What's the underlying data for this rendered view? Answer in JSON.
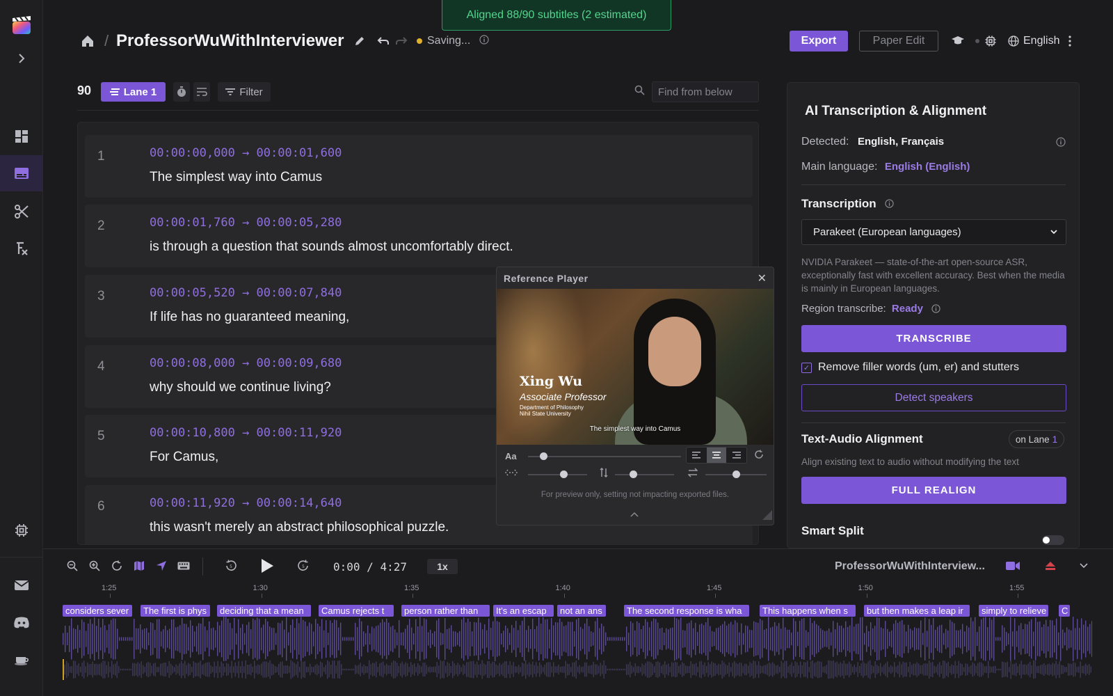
{
  "toast": "Aligned 88/90 subtitles (2 estimated)",
  "header": {
    "separator": "/",
    "title": "ProfessorWuWithInterviewer",
    "saving": "Saving...",
    "export_label": "Export",
    "paper_edit_label": "Paper Edit",
    "language": "English"
  },
  "list_toolbar": {
    "count": "90",
    "lane_label": "Lane 1",
    "filter_label": "Filter",
    "find_placeholder": "Find from below"
  },
  "subtitles": [
    {
      "num": "1",
      "start": "00:00:00,000",
      "end": "00:00:01,600",
      "text": "The simplest way into Camus"
    },
    {
      "num": "2",
      "start": "00:00:01,760",
      "end": "00:00:05,280",
      "text": "is through a question that sounds almost uncomfortably direct."
    },
    {
      "num": "3",
      "start": "00:00:05,520",
      "end": "00:00:07,840",
      "text": "If life has no guaranteed meaning,"
    },
    {
      "num": "4",
      "start": "00:00:08,000",
      "end": "00:00:09,680",
      "text": "why should we continue living?"
    },
    {
      "num": "5",
      "start": "00:00:10,800",
      "end": "00:00:11,920",
      "text": "For Camus,"
    },
    {
      "num": "6",
      "start": "00:00:11,920",
      "end": "00:00:14,640",
      "text": "this wasn't merely an abstract philosophical puzzle."
    }
  ],
  "player": {
    "title": "Reference Player",
    "lower_third": {
      "name": "Xing Wu",
      "role": "Associate Professor",
      "department": "Department of Philosophy",
      "university": "Nihil State University"
    },
    "caption": "The simplest way into Camus",
    "font_label": "Aa",
    "note": "For preview only, setting not impacting exported files.",
    "font_size_level": 0.1,
    "h_offset_level": 0.6,
    "v_offset_level": 0.3,
    "spacing_level": 0.5
  },
  "panel": {
    "title": "AI Transcription & Alignment",
    "detected_label": "Detected:",
    "detected_value": "English, Français",
    "main_language_label": "Main language:",
    "main_language_value": "English (English)",
    "transcription_heading": "Transcription",
    "model_selected": "Parakeet (European languages)",
    "model_description": "NVIDIA Parakeet — state-of-the-art open-source ASR, exceptionally fast with excellent accuracy. Best when the media is mainly in European languages.",
    "region_label": "Region transcribe:",
    "region_value": "Ready",
    "transcribe_label": "TRANSCRIBE",
    "filler_label": "Remove filler words (um, er) and stutters",
    "filler_checked": true,
    "detect_speakers_label": "Detect speakers",
    "alignment_heading": "Text-Audio Alignment",
    "lane_pill_prefix": "on Lane",
    "lane_pill_num": "1",
    "alignment_description": "Align existing text to audio without modifying the text",
    "realign_label": "FULL REALIGN",
    "smart_split_heading": "Smart Split",
    "smart_split_on": false
  },
  "timeline": {
    "current": "0:00",
    "separator": "/",
    "duration": "4:27",
    "speed": "1x",
    "media_title": "ProfessorWuWithInterview...",
    "ticks": [
      "1:25",
      "1:30",
      "1:35",
      "1:40",
      "1:45",
      "1:50",
      "1:55"
    ],
    "segments": [
      "considers sever",
      "The first is phys",
      "deciding that a mean",
      "Camus rejects t",
      "person rather than",
      "It's an escap",
      "not an ans",
      "The second response is wha",
      "This happens when s",
      "but then makes a leap ir",
      "simply to relieve",
      "C"
    ]
  },
  "colors": {
    "accent": "#7b56d6",
    "accent_text": "#8f6ee0",
    "success": "#54d58d",
    "saving_dot": "#e0b22c"
  }
}
